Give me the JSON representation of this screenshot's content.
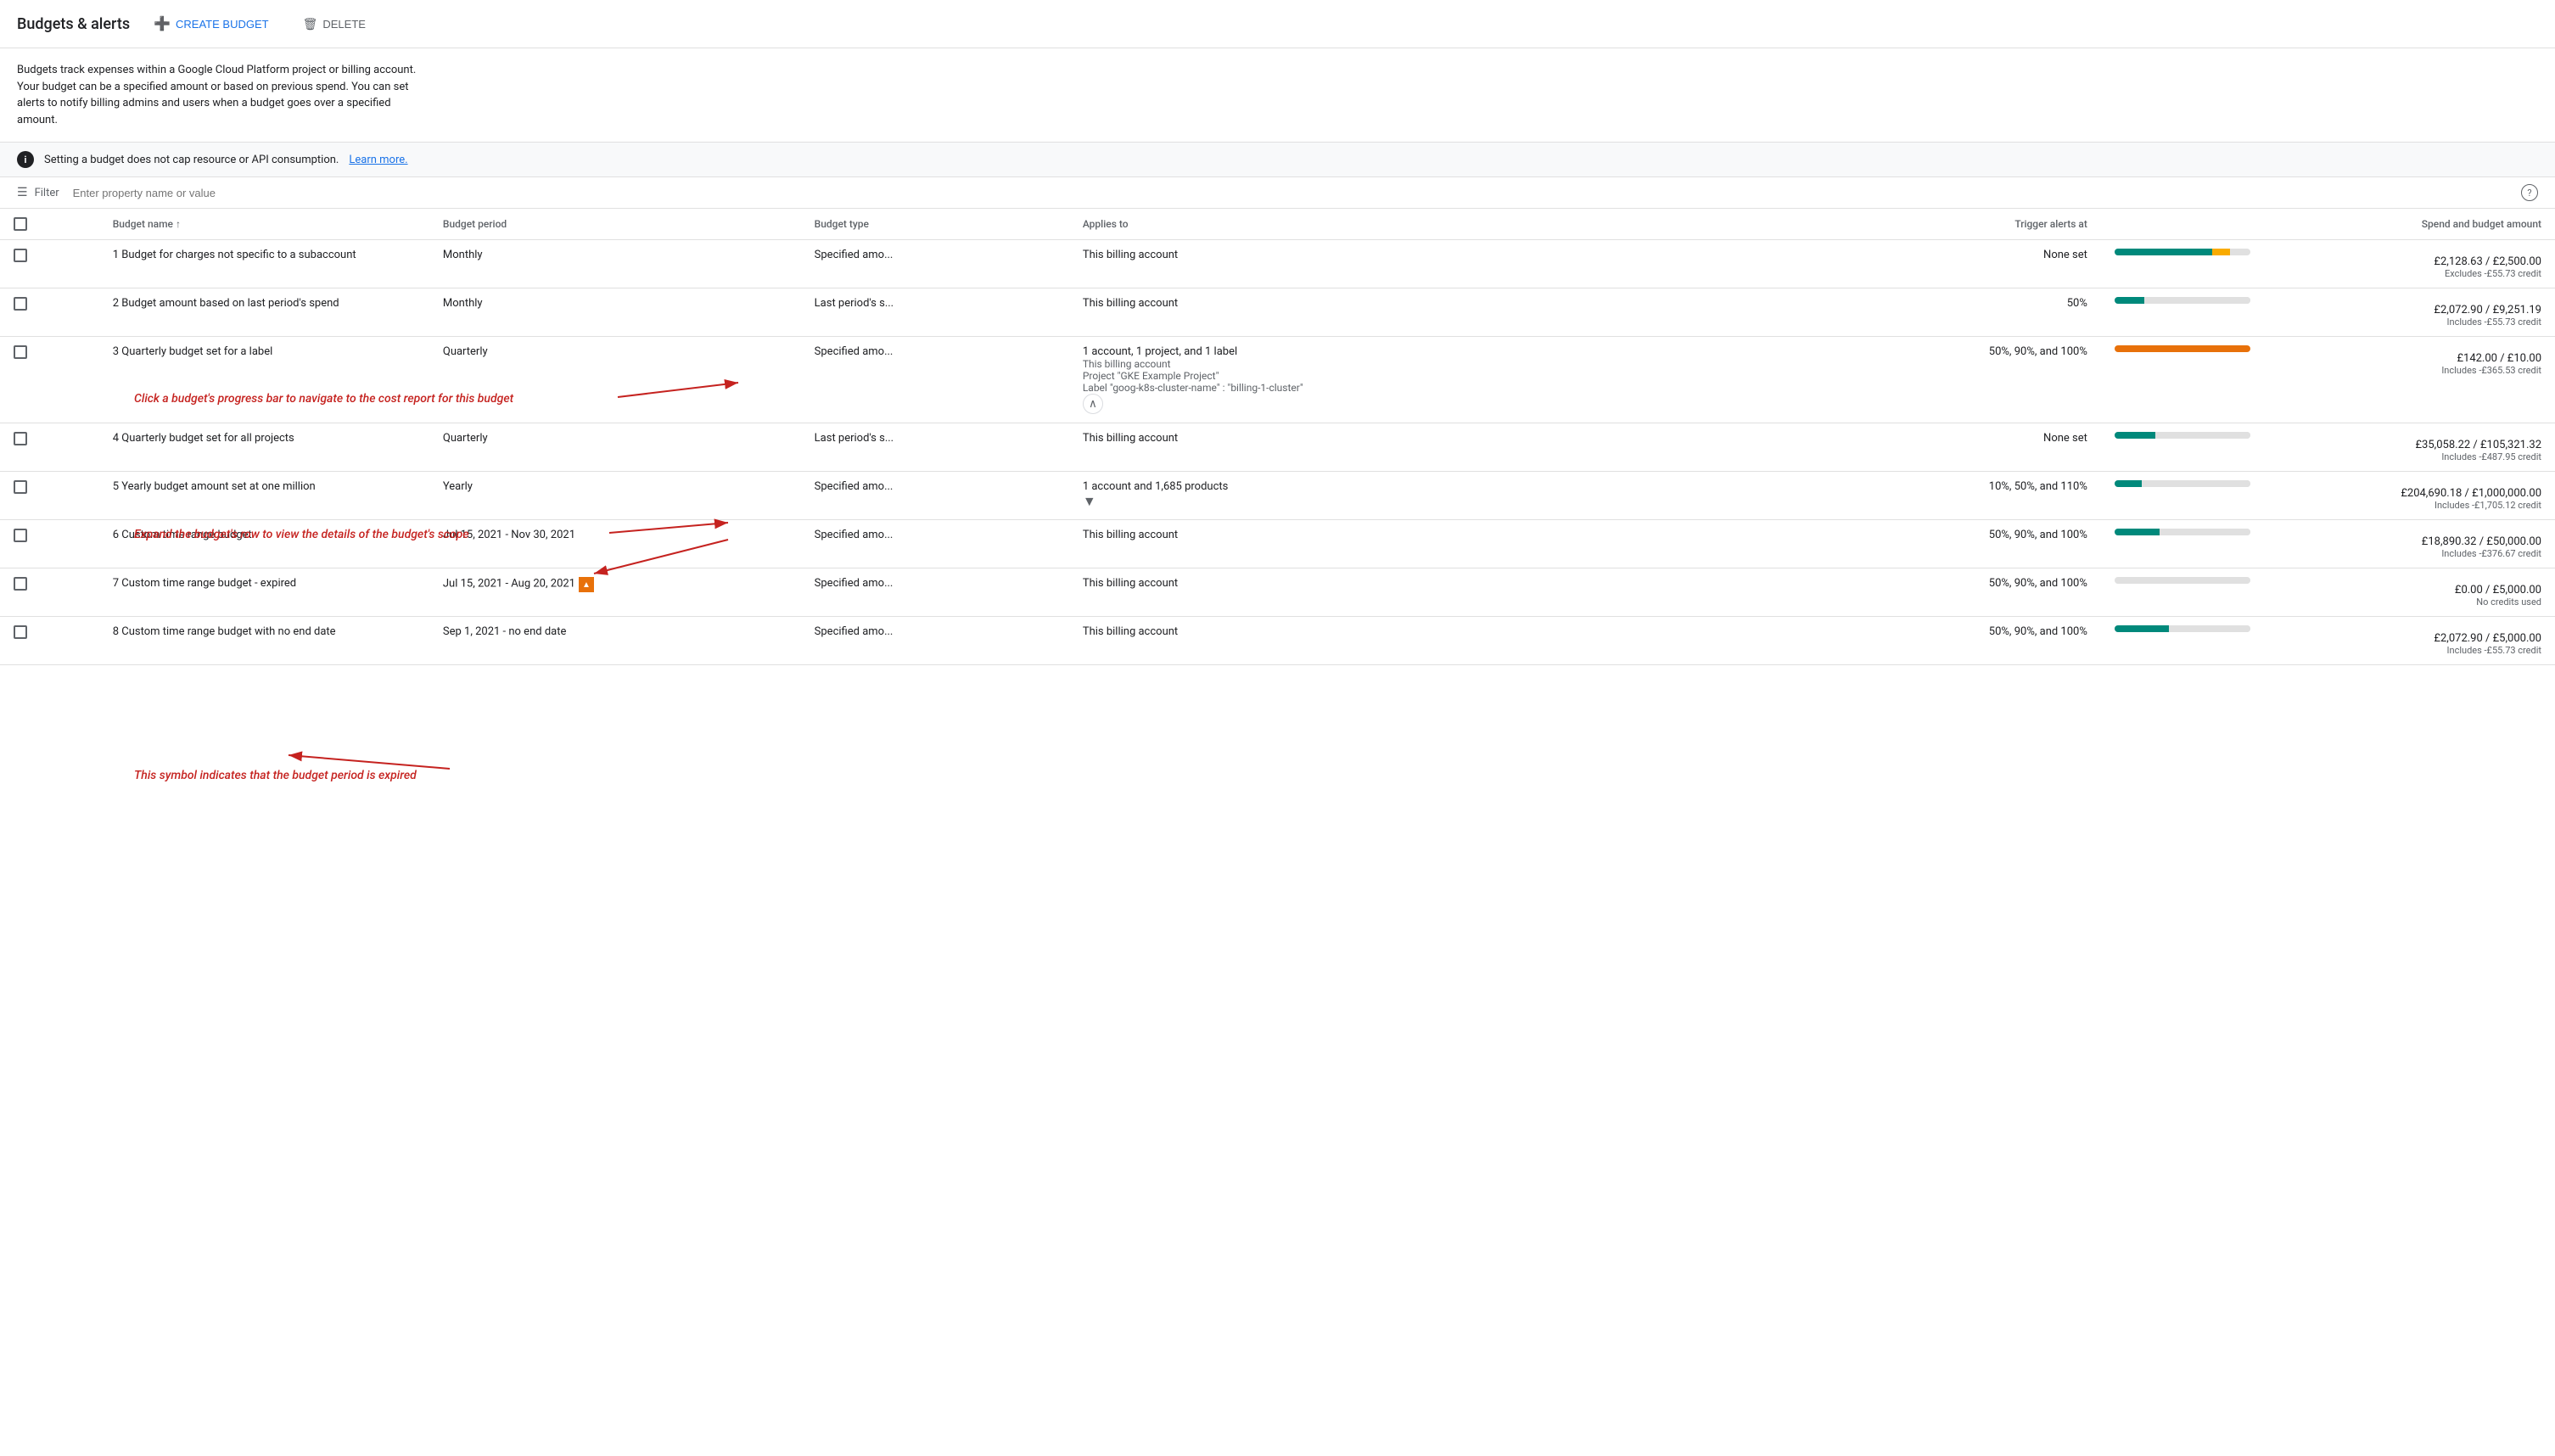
{
  "header": {
    "title": "Budgets & alerts",
    "create_label": "CREATE BUDGET",
    "delete_label": "DELETE"
  },
  "description": {
    "text": "Budgets track expenses within a Google Cloud Platform project or billing account. Your budget can be a specified amount or based on previous spend. You can set alerts to notify billing admins and users when a budget goes over a specified amount."
  },
  "info_banner": {
    "text": "Setting a budget does not cap resource or API consumption.",
    "learn_more": "Learn more."
  },
  "filter": {
    "placeholder": "Enter property name or value"
  },
  "table": {
    "columns": [
      {
        "id": "check",
        "label": ""
      },
      {
        "id": "name",
        "label": "Budget name ↑"
      },
      {
        "id": "period",
        "label": "Budget period"
      },
      {
        "id": "type",
        "label": "Budget type"
      },
      {
        "id": "applies",
        "label": "Applies to"
      },
      {
        "id": "trigger",
        "label": "Trigger alerts at"
      },
      {
        "id": "spend",
        "label": "Spend and budget amount"
      }
    ],
    "rows": [
      {
        "id": 1,
        "name": "1 Budget for charges not specific to a subaccount",
        "period": "Monthly",
        "type": "Specified amo...",
        "applies_to": "This billing account",
        "applies_sub": [],
        "trigger": "None set",
        "amount_main": "£2,128.63 / £2,500.00",
        "amount_sub": "Excludes -£55.73 credit",
        "progress": [
          {
            "pct": 72,
            "color": "teal"
          },
          {
            "pct": 13,
            "color": "yellow"
          },
          {
            "pct": 0,
            "color": "light"
          }
        ],
        "has_expand": false,
        "expired": false
      },
      {
        "id": 2,
        "name": "2 Budget amount based on last period's spend",
        "period": "Monthly",
        "type": "Last period's s...",
        "applies_to": "This billing account",
        "applies_sub": [],
        "trigger": "50%",
        "amount_main": "£2,072.90 / £9,251.19",
        "amount_sub": "Includes -£55.73 credit",
        "progress": [
          {
            "pct": 22,
            "color": "teal"
          },
          {
            "pct": 78,
            "color": "light"
          }
        ],
        "has_expand": false,
        "expired": false
      },
      {
        "id": 3,
        "name": "3 Quarterly budget set for a label",
        "period": "Quarterly",
        "type": "Specified amo...",
        "applies_to": "1 account, 1 project, and 1 label",
        "applies_sub": [
          "This billing account",
          "Project \"GKE Example Project\"",
          "Label \"goog-k8s-cluster-name\" : \"billing-1-cluster\""
        ],
        "trigger": "50%, 90%, and 100%",
        "amount_main": "£142.00 / £10.00",
        "amount_sub": "Includes -£365.53 credit",
        "progress": [
          {
            "pct": 100,
            "color": "orange"
          }
        ],
        "has_expand": true,
        "expanded": true,
        "expired": false
      },
      {
        "id": 4,
        "name": "4 Quarterly budget set for all projects",
        "period": "Quarterly",
        "type": "Last period's s...",
        "applies_to": "This billing account",
        "applies_sub": [],
        "trigger": "None set",
        "amount_main": "£35,058.22 / £105,321.32",
        "amount_sub": "Includes -£487.95 credit",
        "progress": [
          {
            "pct": 30,
            "color": "teal"
          },
          {
            "pct": 70,
            "color": "light"
          }
        ],
        "has_expand": false,
        "expired": false
      },
      {
        "id": 5,
        "name": "5 Yearly budget amount set at one million",
        "period": "Yearly",
        "type": "Specified amo...",
        "applies_to": "1 account and 1,685 products",
        "applies_sub": [],
        "trigger": "10%, 50%, and 110%",
        "amount_main": "£204,690.18 / £1,000,000.00",
        "amount_sub": "Includes -£1,705.12 credit",
        "progress": [
          {
            "pct": 20,
            "color": "teal"
          },
          {
            "pct": 80,
            "color": "light"
          }
        ],
        "has_expand": true,
        "expanded": false,
        "expired": false
      },
      {
        "id": 6,
        "name": "6 Custom time range budget",
        "period": "Jul 15, 2021 - Nov 30, 2021",
        "type": "Specified amo...",
        "applies_to": "This billing account",
        "applies_sub": [],
        "trigger": "50%, 90%, and 100%",
        "amount_main": "£18,890.32 / £50,000.00",
        "amount_sub": "Includes -£376.67 credit",
        "progress": [
          {
            "pct": 33,
            "color": "teal"
          },
          {
            "pct": 67,
            "color": "light"
          }
        ],
        "has_expand": false,
        "expired": false
      },
      {
        "id": 7,
        "name": "7 Custom time range budget - expired",
        "period": "Jul 15, 2021 - Aug 20, 2021",
        "type": "Specified amo...",
        "applies_to": "This billing account",
        "applies_sub": [],
        "trigger": "50%, 90%, and 100%",
        "amount_main": "£0.00 / £5,000.00",
        "amount_sub": "No credits used",
        "progress": [
          {
            "pct": 0,
            "color": "light"
          }
        ],
        "has_expand": false,
        "expired": true
      },
      {
        "id": 8,
        "name": "8 Custom time range budget with no end date",
        "period": "Sep 1, 2021 - no end date",
        "type": "Specified amo...",
        "applies_to": "This billing account",
        "applies_sub": [],
        "trigger": "50%, 90%, and 100%",
        "amount_main": "£2,072.90 / £5,000.00",
        "amount_sub": "Includes -£55.73 credit",
        "progress": [
          {
            "pct": 40,
            "color": "teal"
          },
          {
            "pct": 60,
            "color": "light"
          }
        ],
        "has_expand": false,
        "expired": false
      }
    ]
  },
  "annotations": {
    "arrow1": "Click a budget's progress bar to navigate to the cost report for this budget",
    "arrow2": "Expand the budget's row to view the details of the budget's scope",
    "arrow3": "This symbol indicates that the budget period is expired"
  }
}
